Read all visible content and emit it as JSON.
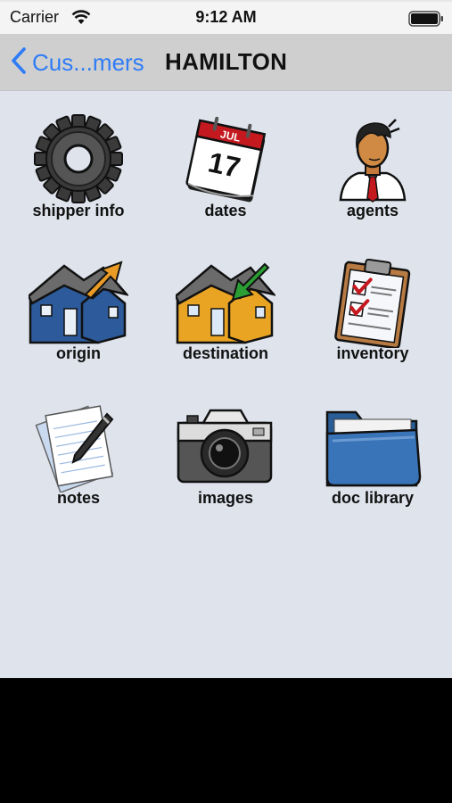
{
  "status_bar": {
    "carrier": "Carrier",
    "time": "9:12 AM"
  },
  "nav": {
    "back_label": "Cus...mers",
    "title": "HAMILTON"
  },
  "calendar_icon": {
    "month": "JUL",
    "day": "17"
  },
  "tiles": [
    {
      "label": "shipper info",
      "icon": "gear-icon"
    },
    {
      "label": "dates",
      "icon": "calendar-icon"
    },
    {
      "label": "agents",
      "icon": "agent-icon"
    },
    {
      "label": "origin",
      "icon": "house-origin-icon"
    },
    {
      "label": "destination",
      "icon": "house-destination-icon"
    },
    {
      "label": "inventory",
      "icon": "clipboard-icon"
    },
    {
      "label": "notes",
      "icon": "notes-icon"
    },
    {
      "label": "images",
      "icon": "camera-icon"
    },
    {
      "label": "doc library",
      "icon": "folder-icon"
    }
  ],
  "colors": {
    "accent": "#2f7cf6",
    "background": "#dee3ec",
    "navbar": "#cfcfcf"
  }
}
